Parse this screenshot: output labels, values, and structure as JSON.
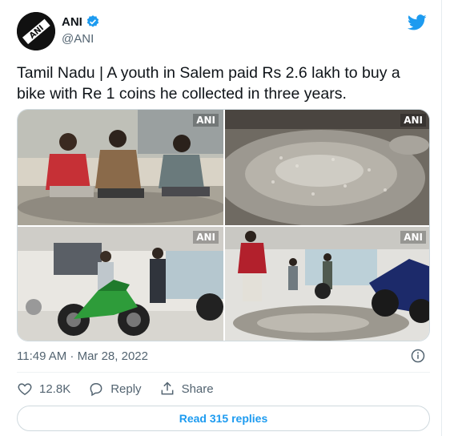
{
  "author": {
    "name": "ANI",
    "handle": "@ANI",
    "avatar_text": "ANI",
    "verified_icon": "verified-badge-icon"
  },
  "brand_icon": "twitter-bird-icon",
  "tweet": {
    "text": "Tamil Nadu | A youth in Salem paid Rs 2.6 lakh to buy a bike with Re 1 coins he collected in three years."
  },
  "media": {
    "watermark": "ANI",
    "photos": [
      "photo-men-counting-coins",
      "photo-coin-pile",
      "photo-showroom-green-bike",
      "photo-showroom-coins-floor"
    ]
  },
  "meta": {
    "timestamp": "11:49 AM · Mar 28, 2022",
    "info_icon": "info-icon"
  },
  "actions": {
    "like_count": "12.8K",
    "reply_label": "Reply",
    "share_label": "Share"
  },
  "read_replies_label": "Read 315 replies",
  "colors": {
    "accent": "#1d9bf0",
    "heart": "#536471",
    "text": "#0f1419",
    "muted": "#536471"
  }
}
